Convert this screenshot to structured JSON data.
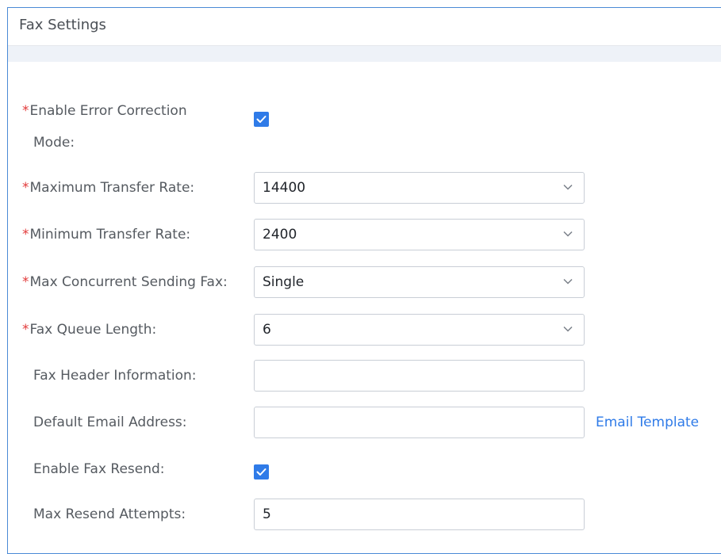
{
  "panel": {
    "title": "Fax Settings"
  },
  "fields": {
    "ecm": {
      "label_line1": "Enable Error Correction",
      "label_line2": "Mode:",
      "checked": true
    },
    "max_rate": {
      "label": "Maximum Transfer Rate:",
      "value": "14400"
    },
    "min_rate": {
      "label": "Minimum Transfer Rate:",
      "value": "2400"
    },
    "max_concurrent": {
      "label": "Max Concurrent Sending Fax:",
      "value": "Single"
    },
    "queue_length": {
      "label": "Fax Queue Length:",
      "value": "6"
    },
    "header_info": {
      "label": "Fax Header Information:",
      "value": ""
    },
    "default_email": {
      "label": "Default Email Address:",
      "value": "",
      "link": "Email Template"
    },
    "fax_resend": {
      "label": "Enable Fax Resend:",
      "checked": true
    },
    "max_resend": {
      "label": "Max Resend Attempts:",
      "value": "5"
    }
  },
  "required_marker": "*",
  "colors": {
    "accent": "#2f7be8",
    "required": "#e23a3a",
    "border": "#4a8ad6"
  },
  "icons": {
    "checkbox": "check-icon",
    "select": "chevron-down-icon"
  }
}
